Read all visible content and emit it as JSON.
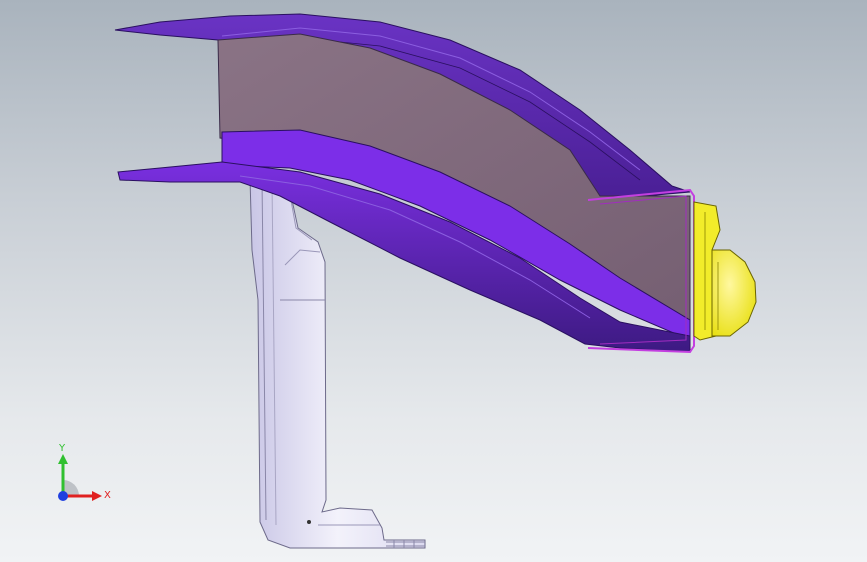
{
  "viewport": {
    "background_top": "#a9b3bd",
    "background_bottom": "#f1f3f5"
  },
  "model": {
    "parts": [
      {
        "name": "rail-section",
        "color": "#5b2ca8"
      },
      {
        "name": "rail-core",
        "color": "#7f6a7c"
      },
      {
        "name": "bracket",
        "color": "#e8e6f6"
      },
      {
        "name": "end-cap",
        "color": "#f2ec2a"
      }
    ]
  },
  "triad": {
    "x_label": "X",
    "y_label": "Y",
    "x_color": "#e02020",
    "y_color": "#30c030",
    "z_color": "#2040e0"
  }
}
